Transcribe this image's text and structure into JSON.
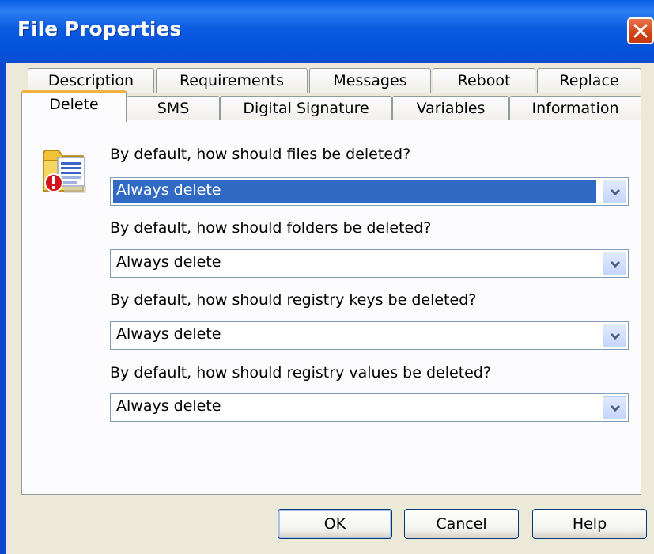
{
  "window": {
    "title": "File Properties"
  },
  "tabs_row1": [
    {
      "label": "Description"
    },
    {
      "label": "Requirements"
    },
    {
      "label": "Messages"
    },
    {
      "label": "Reboot"
    },
    {
      "label": "Replace"
    }
  ],
  "tabs_row2": [
    {
      "label": "Delete",
      "active": true
    },
    {
      "label": "SMS"
    },
    {
      "label": "Digital Signature"
    },
    {
      "label": "Variables"
    },
    {
      "label": "Information"
    }
  ],
  "fields": [
    {
      "question": "By default, how should files be deleted?",
      "value": "Always delete",
      "focused": true
    },
    {
      "question": "By default, how should folders be deleted?",
      "value": "Always delete"
    },
    {
      "question": "By default, how should registry keys be deleted?",
      "value": "Always delete"
    },
    {
      "question": "By default, how should registry values be deleted?",
      "value": "Always delete"
    }
  ],
  "buttons": {
    "ok": "OK",
    "cancel": "Cancel",
    "help": "Help"
  },
  "icons": {
    "close": "close-icon",
    "panel": "delete-file-warning-icon",
    "dropdown": "chevron-down-icon"
  },
  "colors": {
    "titlebar": "#0553dc",
    "selection": "#316ac5",
    "active_tab_accent": "#f5b042",
    "close_button": "#d24217"
  }
}
